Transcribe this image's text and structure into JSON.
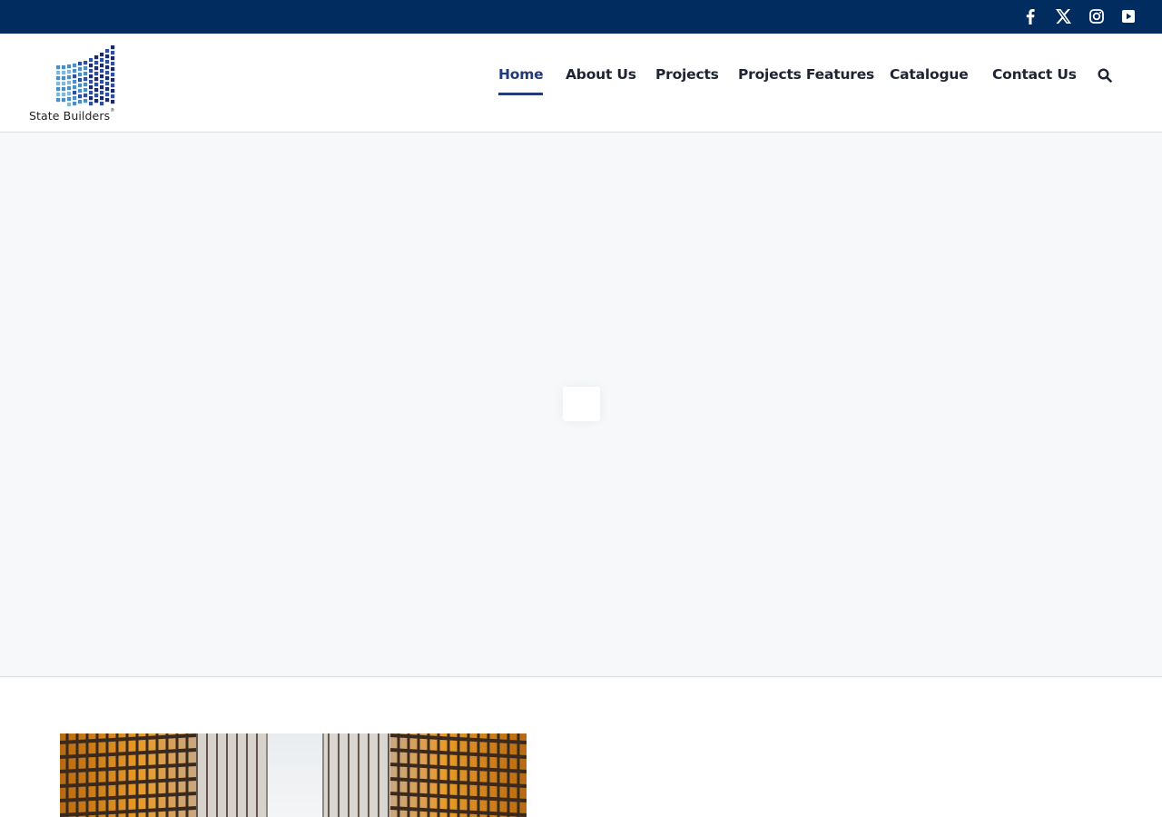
{
  "topbar": {
    "background": "#002c5f",
    "social": [
      {
        "name": "facebook-icon",
        "label": "Facebook"
      },
      {
        "name": "x-twitter-icon",
        "label": "X"
      },
      {
        "name": "instagram-icon",
        "label": "Instagram"
      },
      {
        "name": "youtube-icon",
        "label": "YouTube"
      }
    ]
  },
  "logo": {
    "text": "State Builders",
    "registered": "®",
    "colors": [
      "#1b2a6b",
      "#2c4ea3",
      "#4a90c8",
      "#7fb8dc"
    ]
  },
  "nav": {
    "items": [
      {
        "label": "Home",
        "active": true
      },
      {
        "label": "About Us",
        "active": false
      },
      {
        "label": "Projects",
        "active": false
      },
      {
        "label": "Projects Features",
        "active": false
      },
      {
        "label": "Catalogue",
        "active": false
      },
      {
        "label": "Contact Us",
        "active": false
      }
    ],
    "search_icon": "search-icon",
    "active_color": "#233a7a"
  },
  "slider": {
    "state": "loading",
    "background": "#f7f8fa"
  },
  "content": {
    "image": "skyscrapers-glass-facade"
  }
}
